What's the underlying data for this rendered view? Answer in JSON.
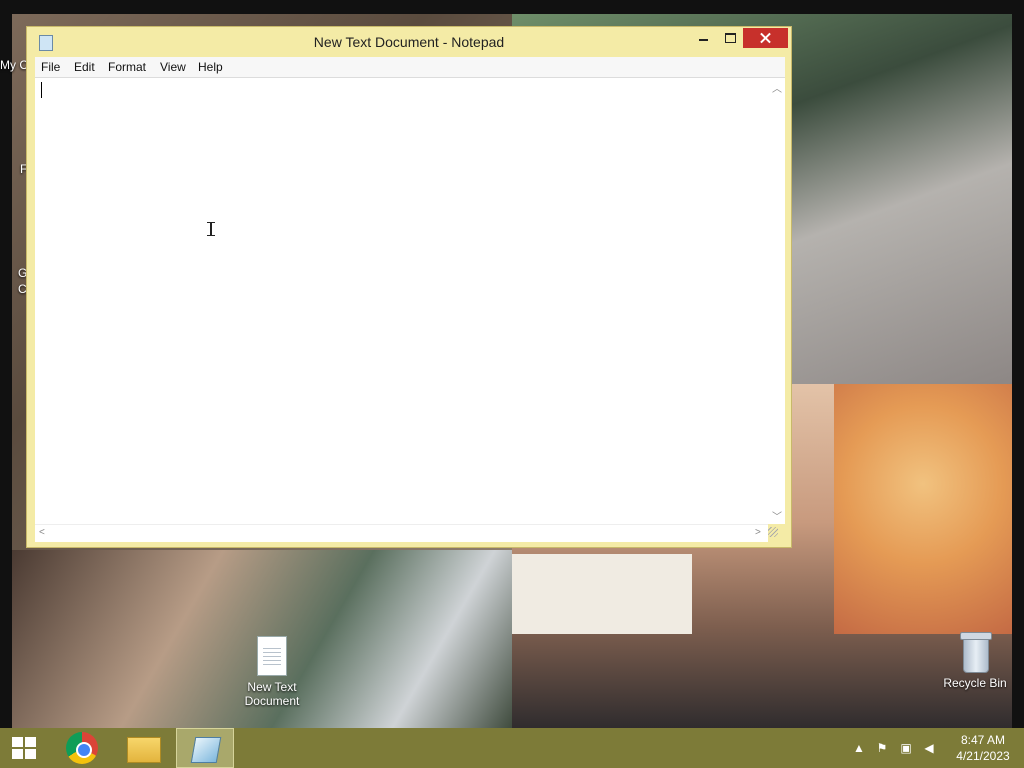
{
  "window": {
    "title": "New Text Document - Notepad",
    "menus": [
      "File",
      "Edit",
      "Format",
      "View",
      "Help"
    ],
    "content": ""
  },
  "desktop": {
    "icons": [
      {
        "label": "New Text Document",
        "icon": "text-document-icon"
      },
      {
        "label": "Recycle Bin",
        "icon": "recycle-bin-icon"
      }
    ],
    "partial_icon_labels": [
      "My C",
      "F",
      "G",
      "C"
    ]
  },
  "taskbar": {
    "apps": [
      "start-icon",
      "chrome-icon",
      "file-explorer-icon",
      "notepad-icon"
    ],
    "tray": [
      "chevron-up-icon",
      "flag-icon",
      "network-icon",
      "volume-muted-icon"
    ],
    "time": "8:47 AM",
    "date": "4/21/2023"
  },
  "colors": {
    "window_frame": "#f4eba6",
    "close_button": "#c7302b",
    "taskbar": "#7d7b38"
  }
}
